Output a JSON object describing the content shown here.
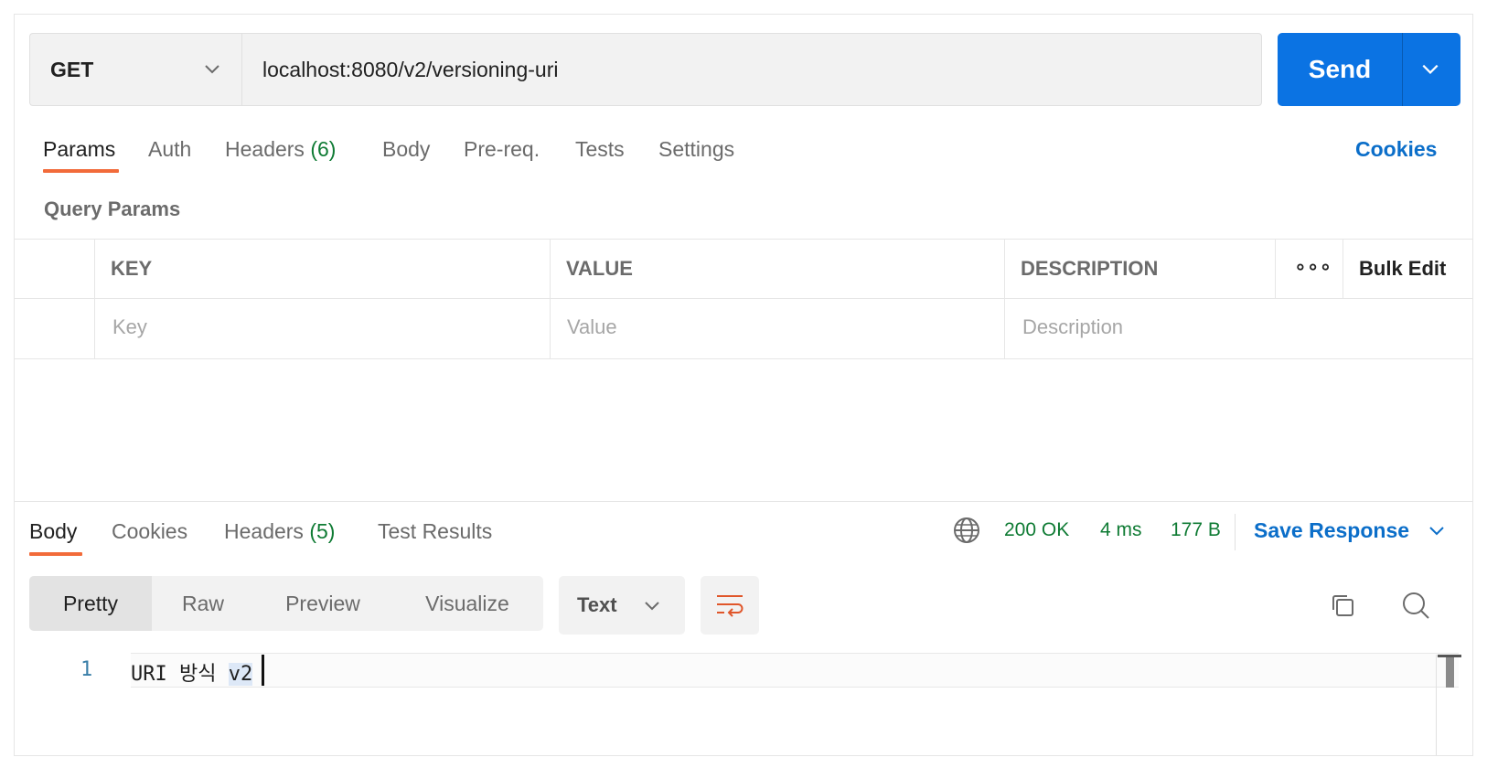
{
  "request": {
    "method": "GET",
    "url": "localhost:8080/v2/versioning-uri",
    "send_label": "Send"
  },
  "request_tabs": {
    "params": "Params",
    "auth": "Auth",
    "headers": "Headers",
    "headers_count": "(6)",
    "body": "Body",
    "prereq": "Pre-req.",
    "tests": "Tests",
    "settings": "Settings",
    "cookies": "Cookies"
  },
  "query_params": {
    "title": "Query Params",
    "headers": {
      "key": "KEY",
      "value": "VALUE",
      "description": "DESCRIPTION",
      "more": "∘∘∘",
      "bulk_edit": "Bulk Edit"
    },
    "placeholders": {
      "key": "Key",
      "value": "Value",
      "description": "Description"
    }
  },
  "response_tabs": {
    "body": "Body",
    "cookies": "Cookies",
    "headers": "Headers",
    "headers_count": "(5)",
    "test_results": "Test Results"
  },
  "response_status": {
    "status": "200 OK",
    "time": "4 ms",
    "size": "177 B",
    "save": "Save Response"
  },
  "view_modes": {
    "pretty": "Pretty",
    "raw": "Raw",
    "preview": "Preview",
    "visualize": "Visualize",
    "format": "Text"
  },
  "code": {
    "line_number": "1",
    "text_plain": "URI 방식 ",
    "text_selected": "v2"
  },
  "colors": {
    "accent_orange": "#f26b3a",
    "send_blue": "#0b73e3",
    "link_blue": "#0b6ec9",
    "success_green": "#0f7b34"
  }
}
